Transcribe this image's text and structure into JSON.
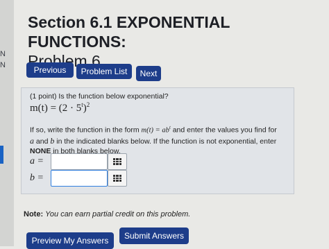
{
  "side": {
    "frag1": "N",
    "frag2": "N"
  },
  "header": {
    "title_line1": "Section 6.1 EXPONENTIAL FUNCTIONS:",
    "title_line2": "Problem 6"
  },
  "nav": {
    "previous": "Previous",
    "problem_list": "Problem List",
    "next": "Next"
  },
  "problem": {
    "points_question": "(1 point) Is the function below exponential?",
    "function_expr": "m(t) = (2 · 5",
    "function_exp_inner": "t",
    "function_close": ")",
    "function_exp_outer": "2",
    "instructions_1_a": "If so, write the function in the form ",
    "instructions_1_form": "m(t) = ab",
    "instructions_1_form_exp": "t",
    "instructions_1_b": " and enter the values you find for",
    "instructions_2_a": "a",
    "instructions_2_mid": " and ",
    "instructions_2_b": "b",
    "instructions_2_rest": " in the indicated blanks below. If the function is not exponential, enter",
    "instructions_3_none": "NONE",
    "instructions_3_rest": " in both blanks below.",
    "field_a_label": "a =",
    "field_b_label": "b =",
    "field_a_value": "",
    "field_b_value": ""
  },
  "footer": {
    "note_label": "Note:",
    "note_text": "You can earn partial credit on this problem.",
    "preview_button": "Preview My Answers",
    "submit_button": "Submit Answers"
  },
  "colors": {
    "button_bg": "#1d3d8a",
    "panel_bg": "#e1e4e8",
    "page_bg": "#e9e9e6"
  }
}
